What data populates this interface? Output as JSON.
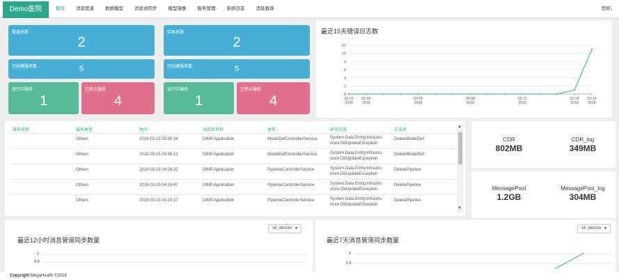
{
  "brand": "Demo医院",
  "nav": [
    "概览",
    "消息管道",
    "数据模型",
    "消息池同步",
    "模型镜像",
    "服务管理",
    "系统日志",
    "消息查询"
  ],
  "user": "您好。",
  "panel1": {
    "pipelines_label": "管道总数",
    "pipelines_value": "2",
    "created_label": "已创建服务数",
    "created_value": "5",
    "running_label": "运行中服务",
    "running_value": "1",
    "stopped_label": "已停止服务",
    "stopped_value": "4"
  },
  "panel2": {
    "entities_label": "实体总数",
    "entities_value": "2",
    "created_label": "已创建服务数",
    "created_value": "5",
    "running_label": "运行中服务",
    "running_value": "1",
    "stopped_label": "已停止服务",
    "stopped_value": "4"
  },
  "chart_data": {
    "type": "line",
    "title": "最近15天错误日志数",
    "x": [
      "03-01 2018",
      "03-02 2018",
      "03-03 2018",
      "03-04 2018",
      "03-05 2018",
      "03-06 2018",
      "03-07 2018",
      "03-08 2018",
      "03-09 2018",
      "03-10 2018",
      "03-11 2018",
      "03-12 2018",
      "03-13 2018",
      "03-14 2018",
      "03-15 2018"
    ],
    "x_ticks": [
      [
        "03-01",
        "2018"
      ],
      [
        "03-02",
        "2018"
      ],
      [
        "03-05",
        "2018"
      ],
      [
        "03-08",
        "2018"
      ],
      [
        "03-11",
        "2018"
      ],
      [
        "03-14",
        "2018"
      ],
      [
        "03-15",
        "2018"
      ]
    ],
    "x_tick_index": [
      0,
      1,
      4,
      7,
      10,
      13,
      14
    ],
    "values": [
      0,
      0,
      0,
      0,
      0,
      0,
      0,
      0,
      0,
      0,
      0,
      0,
      0,
      1,
      11
    ],
    "yticks": [
      0,
      2,
      4,
      6,
      8,
      10,
      12
    ],
    "ylim": [
      0,
      12
    ],
    "color": "#5cb89a"
  },
  "table": {
    "headers": [
      "服务名称",
      "服务类型",
      "时间",
      "动态库名称",
      "类名",
      "异常信息",
      "方法名"
    ],
    "rows": [
      [
        "",
        "Others",
        "2018-03-15 05:00:34",
        "DIMP.Application",
        "ModelDefControllerService",
        "System.Data.Entity.Infrastru|cture.DbUpdateException",
        "DeleteModelDef"
      ],
      [
        "",
        "Others",
        "2018-03-15 04:56:13",
        "DIMP.Application",
        "ModelDefControllerService",
        "System.Data.Entity.Infrastru|cture.DbUpdateException",
        "DeleteModelDef"
      ],
      [
        "",
        "Others",
        "2018-03-15 04:26:32",
        "DIMP.Application",
        "PipelineControllerService",
        "System.Data.Entity.Infrastru|cture.DbUpdateException",
        "DeletePipeline"
      ],
      [
        "",
        "Others",
        "2018-03-15 04:24:47",
        "DIMP.Application",
        "PipelineControllerService",
        "System.Data.Entity.Infrastru|cture.DbUpdateException",
        "DeletePipeline"
      ],
      [
        "",
        "Others",
        "2018-03-15 04:24:37",
        "DIMP.Application",
        "PipelineControllerService",
        "System.Data.Entity.Infrastru|cture.DbUpdateException",
        "DeletePipeline"
      ]
    ]
  },
  "databases": [
    {
      "name": "CDR",
      "size": "802MB"
    },
    {
      "name": "CDR_log",
      "size": "349MB"
    },
    {
      "name": "MessagePool",
      "size": "1.2GB"
    },
    {
      "name": "MessagePool_log",
      "size": "304MB"
    }
  ],
  "sync12": {
    "title": "最近12小时消息管道同步数量",
    "select": "SF_BRXXK",
    "yticks": [
      "1",
      "0.8"
    ]
  },
  "sync7": {
    "title": "最近7天消息管道同步数量",
    "select": "SF_BRXXK",
    "yticks": [
      "2",
      "1.5"
    ]
  },
  "footer": {
    "copyright": "Copyright",
    "company": "MegaHealth ©2018"
  }
}
